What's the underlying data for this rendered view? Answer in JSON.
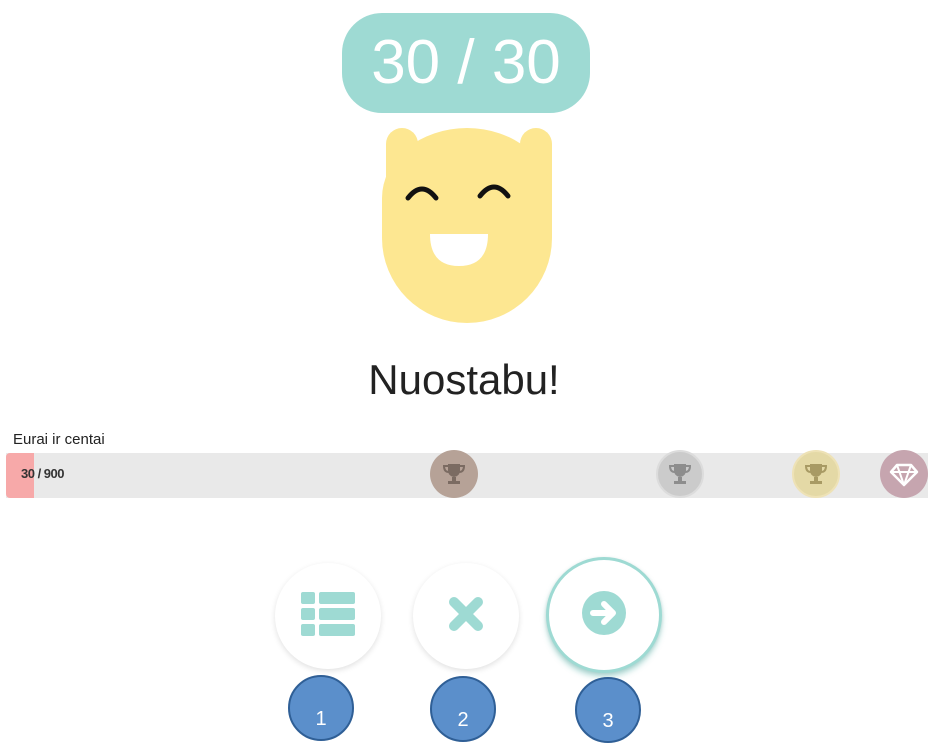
{
  "score": {
    "text": "30 / 30"
  },
  "result": {
    "title": "Nuostabu!"
  },
  "progress": {
    "label": "Eurai ir centai",
    "text": "30 / 900",
    "current": 30,
    "max": 900
  },
  "milestones": [
    {
      "icon": "trophy-icon",
      "tier": "bronze",
      "color": "#b6a297"
    },
    {
      "icon": "trophy-icon",
      "tier": "silver",
      "color": "#cbcbcb"
    },
    {
      "icon": "trophy-icon",
      "tier": "gold",
      "color": "#e4d9a6"
    },
    {
      "icon": "diamond-icon",
      "tier": "diamond",
      "color": "#c6a5af"
    }
  ],
  "actions": [
    {
      "name": "list",
      "icon": "list-icon",
      "badge": "1"
    },
    {
      "name": "close",
      "icon": "close-icon",
      "badge": "2"
    },
    {
      "name": "next",
      "icon": "arrow-right-circle-icon",
      "badge": "3"
    }
  ],
  "colors": {
    "accent": "#9edad3",
    "mascot": "#fde791",
    "progress_fill": "#f7a9a9",
    "badge": "#5b8fcb"
  }
}
